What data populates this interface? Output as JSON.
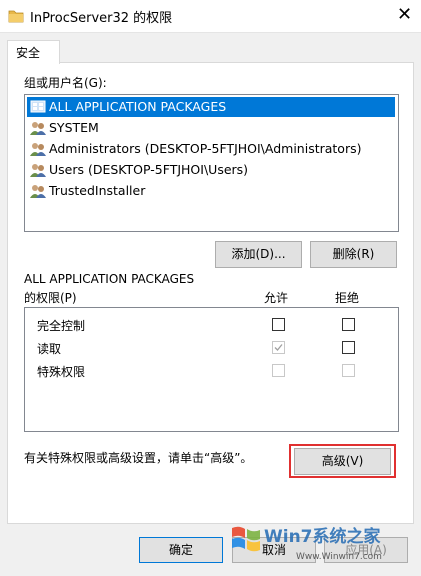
{
  "window": {
    "title": "InProcServer32 的权限",
    "close_glyph": "✕"
  },
  "tabs": [
    {
      "label": "安全"
    }
  ],
  "groups": {
    "label": "组或用户名(G):",
    "items": [
      {
        "name": "ALL APPLICATION PACKAGES",
        "icon": "app-packages-icon",
        "selected": true
      },
      {
        "name": "SYSTEM",
        "icon": "users-icon"
      },
      {
        "name": "Administrators (DESKTOP-5FTJHOI\\Administrators)",
        "icon": "users-icon"
      },
      {
        "name": "Users (DESKTOP-5FTJHOI\\Users)",
        "icon": "users-icon"
      },
      {
        "name": "TrustedInstaller",
        "icon": "users-icon"
      }
    ]
  },
  "buttons": {
    "add": "添加(D)...",
    "remove": "删除(R)",
    "advanced": "高级(V)",
    "ok": "确定",
    "cancel": "取消",
    "apply": "应用(A)"
  },
  "permissions": {
    "label_line1": "ALL APPLICATION PACKAGES",
    "label_line2": "的权限(P)",
    "allow_header": "允许",
    "deny_header": "拒绝",
    "rows": [
      {
        "name": "完全控制",
        "allow": false,
        "deny": false,
        "allow_disabled": false,
        "deny_disabled": false
      },
      {
        "name": "读取",
        "allow": true,
        "deny": false,
        "allow_disabled": true,
        "deny_disabled": false
      },
      {
        "name": "特殊权限",
        "allow": false,
        "deny": false,
        "allow_disabled": true,
        "deny_disabled": true
      }
    ]
  },
  "advanced_hint": "有关特殊权限或高级设置，请单击“高级”。",
  "watermark": {
    "brand": "Win7系统之家",
    "url": "Www.Winwin7.com"
  },
  "colors": {
    "selection": "#0078d7",
    "highlight_border": "#e03030",
    "button_face": "#e1e1e1",
    "dialog_bg": "#f0f0f0"
  }
}
